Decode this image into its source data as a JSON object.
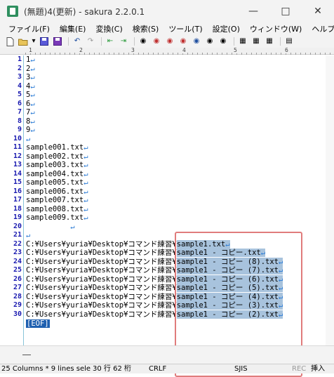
{
  "window": {
    "title": "(無題)4(更新) - sakura 2.2.0.1",
    "minimize_icon": "minimize-icon",
    "maximize_icon": "maximize-icon",
    "close_icon": "close-icon"
  },
  "menu": [
    "ファイル(F)",
    "編集(E)",
    "変換(C)",
    "検索(S)",
    "ツール(T)",
    "設定(O)",
    "ウィンドウ(W)",
    "ヘルプ(H)"
  ],
  "toolbar": [
    "new-file-icon",
    "open-file-icon",
    "dropdown-arrow-icon",
    "save-icon",
    "save-all-icon",
    "undo-icon",
    "redo-icon",
    "jump-back-icon",
    "jump-forward-icon",
    "search-icon",
    "search-prev-icon",
    "search-next-icon",
    "replace-icon",
    "grep-icon",
    "outline-icon",
    "compare-icon",
    "copy-icon",
    "paste-icon",
    "view-icon"
  ],
  "ruler_labels": [
    "1",
    "2",
    "3",
    "4",
    "5",
    "6"
  ],
  "lines": [
    {
      "num": "1",
      "text": "1",
      "ret": "↵"
    },
    {
      "num": "2",
      "text": "2",
      "ret": "↵"
    },
    {
      "num": "3",
      "text": "3",
      "ret": "↵"
    },
    {
      "num": "4",
      "text": "4",
      "ret": "↵"
    },
    {
      "num": "5",
      "text": "5",
      "ret": "↵"
    },
    {
      "num": "6",
      "text": "6",
      "ret": "↵"
    },
    {
      "num": "7",
      "text": "7",
      "ret": "↵"
    },
    {
      "num": "8",
      "text": "8",
      "ret": "↵"
    },
    {
      "num": "9",
      "text": "9",
      "ret": "↵"
    },
    {
      "num": "10",
      "text": "",
      "ret": "↵"
    },
    {
      "num": "11",
      "text": "sample001.txt",
      "ret": "↵"
    },
    {
      "num": "12",
      "text": "sample002.txt",
      "ret": "↵"
    },
    {
      "num": "13",
      "text": "sample003.txt",
      "ret": "↵"
    },
    {
      "num": "14",
      "text": "sample004.txt",
      "ret": "↵"
    },
    {
      "num": "15",
      "text": "sample005.txt",
      "ret": "↵"
    },
    {
      "num": "16",
      "text": "sample006.txt",
      "ret": "↵"
    },
    {
      "num": "17",
      "text": "sample007.txt",
      "ret": "↵"
    },
    {
      "num": "18",
      "text": "sample008.txt",
      "ret": "↵"
    },
    {
      "num": "19",
      "text": "sample009.txt",
      "ret": "↵"
    },
    {
      "num": "20",
      "text": "          ",
      "ret": "↵"
    },
    {
      "num": "21",
      "text": "",
      "ret": "↵"
    },
    {
      "num": "22",
      "text": "C:¥Users¥yuria¥Desktop¥コマンド練習¥",
      "sel": "sample1.txt",
      "ret": "↵"
    },
    {
      "num": "23",
      "text": "C:¥Users¥yuria¥Desktop¥コマンド練習¥",
      "sel": "sample1 - コピー.txt",
      "ret": "↵"
    },
    {
      "num": "24",
      "text": "C:¥Users¥yuria¥Desktop¥コマンド練習¥",
      "sel": "sample1 - コピー (8).txt",
      "ret": "↵"
    },
    {
      "num": "25",
      "text": "C:¥Users¥yuria¥Desktop¥コマンド練習¥",
      "sel": "sample1 - コピー (7).txt",
      "ret": "↵"
    },
    {
      "num": "26",
      "text": "C:¥Users¥yuria¥Desktop¥コマンド練習¥",
      "sel": "sample1 - コピー (6).txt",
      "ret": "↵"
    },
    {
      "num": "27",
      "text": "C:¥Users¥yuria¥Desktop¥コマンド練習¥",
      "sel": "sample1 - コピー (5).txt",
      "ret": "↵"
    },
    {
      "num": "28",
      "text": "C:¥Users¥yuria¥Desktop¥コマンド練習¥",
      "sel": "sample1 - コピー (4).txt",
      "ret": "↵"
    },
    {
      "num": "29",
      "text": "C:¥Users¥yuria¥Desktop¥コマンド練習¥",
      "sel": "sample1 - コピー (3).txt",
      "ret": "↵"
    },
    {
      "num": "30",
      "text": "C:¥Users¥yuria¥Desktop¥コマンド練習¥",
      "sel": "sample1 - コピー (2).txt",
      "ret": "↵"
    }
  ],
  "eof": "[EOF]",
  "status": {
    "selection": "25 Columns * 9 lines sele",
    "position": "30 行  62 桁",
    "eol": "CRLF",
    "encoding": "SJIS",
    "rec": "REC",
    "mode": "挿入"
  },
  "colors": {
    "line_number": "#1a1ab0",
    "return_mark": "#2e7dd6",
    "selection": "#a8c3dd",
    "eof_bg": "#1f60b0",
    "highlight_box": "#e07c7c"
  }
}
